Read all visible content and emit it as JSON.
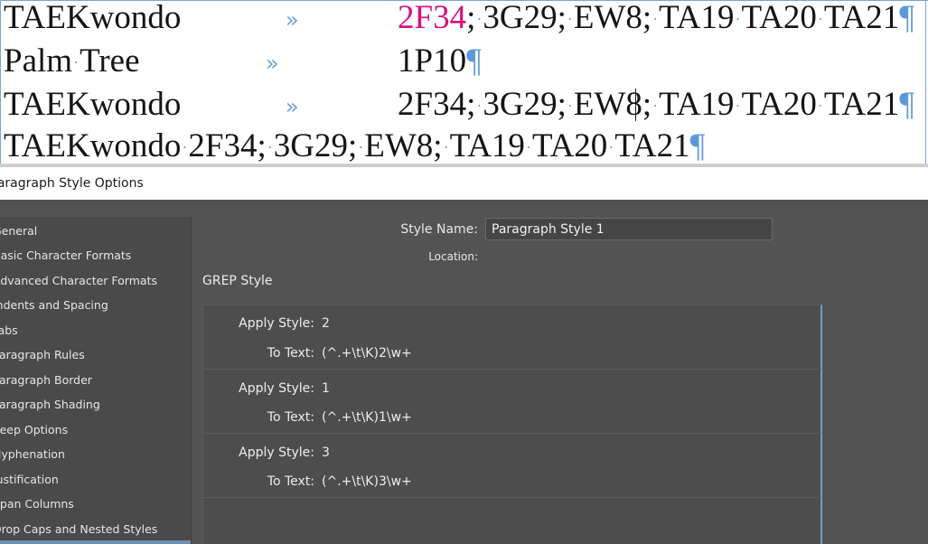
{
  "document": {
    "lines": [
      {
        "col1": "TAEKwondo",
        "codes": [
          {
            "t": "2F34",
            "hl": true
          },
          {
            "t": "; "
          },
          {
            "t": "3G29; "
          },
          {
            "t": "EW8; "
          },
          {
            "t": "TA19 "
          },
          {
            "t": "TA20 "
          },
          {
            "t": "TA21"
          }
        ],
        "pilcrow": "¶"
      },
      {
        "col1": "Palm Tree",
        "codes": [
          {
            "t": "1P10"
          }
        ],
        "pilcrow": "¶"
      },
      {
        "col1": "TAEKwondo",
        "codes": [
          {
            "t": "2F34; "
          },
          {
            "t": "3G29; "
          },
          {
            "t": "EW8; "
          },
          {
            "t": "TA19 "
          },
          {
            "t": "TA20 "
          },
          {
            "t": "TA21"
          }
        ],
        "pilcrow": "¶"
      },
      {
        "full": "TAEKwondo 2F34; 3G29; EW8; TA19 TA20 TA21",
        "pilcrow": "¶"
      }
    ],
    "tab_marker": "»"
  },
  "dialog": {
    "title": "Paragraph Style Options",
    "sidebar": [
      "General",
      "Basic Character Formats",
      "Advanced Character Formats",
      "Indents and Spacing",
      "Tabs",
      "Paragraph Rules",
      "Paragraph Border",
      "Paragraph Shading",
      "Keep Options",
      "Hyphenation",
      "Justification",
      "Span Columns",
      "Drop Caps and Nested Styles"
    ],
    "style_name_label": "Style Name:",
    "style_name_value": "Paragraph Style 1",
    "location_label": "Location:",
    "grep_heading": "GREP Style",
    "grep_rules": [
      {
        "apply_label": "Apply Style:",
        "apply_value": "2",
        "text_label": "To Text:",
        "text_value": "(^.+\\t\\K)2\\w+"
      },
      {
        "apply_label": "Apply Style:",
        "apply_value": "1",
        "text_label": "To Text:",
        "text_value": "(^.+\\t\\K)1\\w+"
      },
      {
        "apply_label": "Apply Style:",
        "apply_value": "3",
        "text_label": "To Text:",
        "text_value": "(^.+\\t\\K)3\\w+"
      }
    ]
  },
  "colors": {
    "highlight": "#d4117d",
    "hidden_chars": "#5b9ad8",
    "dialog_bg": "#535353"
  }
}
